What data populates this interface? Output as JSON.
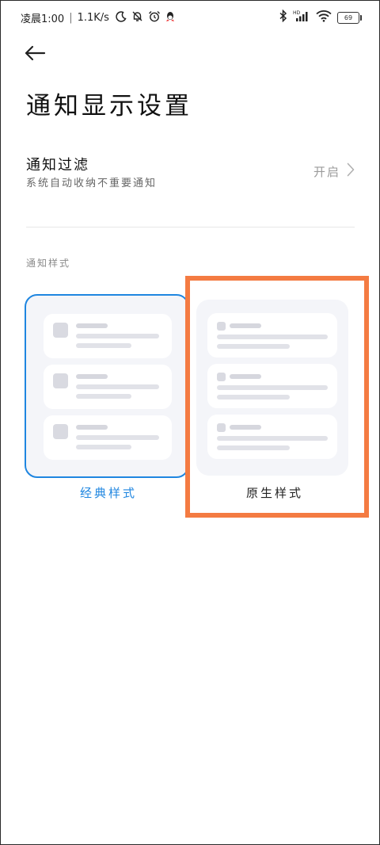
{
  "status_bar": {
    "time": "凌晨1:00",
    "speed": "1.1K/s",
    "battery": "69",
    "icons_left": [
      "moon-icon",
      "bell-off-icon",
      "alarm-icon",
      "qq-icon"
    ],
    "icons_right": [
      "bluetooth-icon",
      "signal-hd-icon",
      "wifi-icon",
      "battery-icon"
    ]
  },
  "header": {
    "back_icon": "arrow-left-icon",
    "title": "通知显示设置"
  },
  "notification_filter": {
    "title": "通知过滤",
    "description": "系统自动收纳不重要通知",
    "value": "开启",
    "chevron_icon": "chevron-right-icon"
  },
  "notification_style": {
    "section_label": "通知样式",
    "options": [
      {
        "label": "经典样式",
        "selected": true
      },
      {
        "label": "原生样式",
        "selected": false
      }
    ]
  },
  "colors": {
    "accent": "#1f86e0",
    "highlight": "#f47b42",
    "preview_bg": "#f4f5f9"
  }
}
